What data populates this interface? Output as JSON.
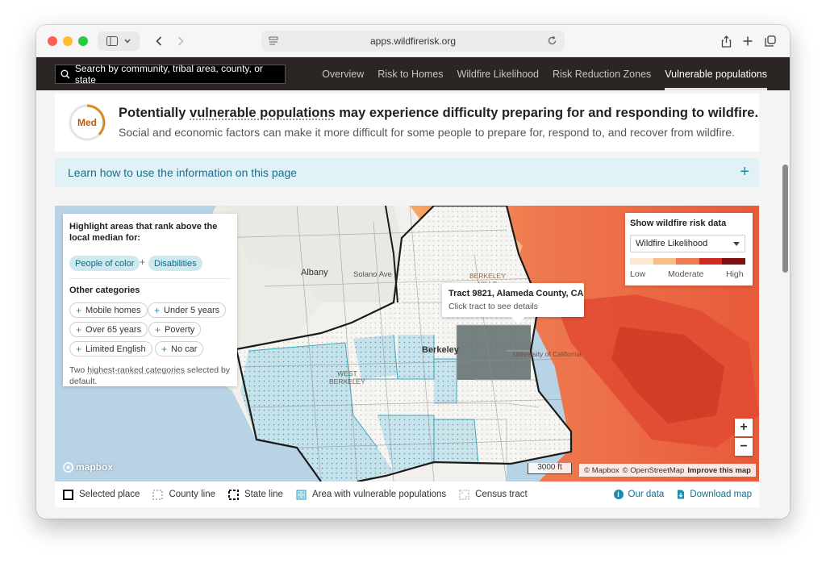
{
  "browser": {
    "url": "apps.wildfirerisk.org"
  },
  "nav": {
    "search_placeholder": "Search by community, tribal area, county, or state",
    "tabs": [
      "Overview",
      "Risk to Homes",
      "Wildfire Likelihood",
      "Risk Reduction Zones",
      "Vulnerable populations"
    ],
    "active_tab": "Vulnerable populations"
  },
  "banner": {
    "gauge_label": "Med",
    "title_pre": "Potentially ",
    "title_link": "vulnerable populations",
    "title_post": " may experience difficulty preparing for and responding to wildfire.",
    "subtitle": "Social and economic factors can make it more difficult for some people to prepare for, respond to, and recover from wildfire."
  },
  "learn": {
    "label": "Learn how to use the information on this page",
    "plus": "+"
  },
  "map": {
    "panel": {
      "heading": "Highlight areas that rank above the local median for:",
      "selected": [
        "People of color",
        "Disabilities"
      ],
      "joiner": "+",
      "other_heading": "Other categories",
      "other": [
        "Mobile homes",
        "Under 5 years",
        "Over 65 years",
        "Poverty",
        "Limited English",
        "No car"
      ],
      "note_pre": "Two ",
      "note_link": "highest-ranked categories",
      "note_post": " selected by default."
    },
    "tooltip": {
      "title": "Tract 9821, Alameda County, CA",
      "subtitle": "Click tract to see details"
    },
    "risk": {
      "title": "Show wildfire risk data",
      "selected": "Wildfire Likelihood",
      "low": "Low",
      "moderate": "Moderate",
      "high": "High",
      "colors": [
        "#fde9cf",
        "#f9bd8a",
        "#ef7a4f",
        "#cf2a20",
        "#7e1010"
      ]
    },
    "labels": {
      "albany": "Albany",
      "solano": "Solano Ave",
      "berkeley": "Berkeley",
      "west_berkeley": "WEST\nBERKELEY",
      "berkeley_hills": "BERKELEY\nHILLS",
      "uc": "University of California"
    },
    "zoom_in": "+",
    "zoom_out": "−",
    "mapbox": "mapbox",
    "scale": "3000 ft",
    "attribution": [
      "© Mapbox",
      "© OpenStreetMap",
      "Improve this map"
    ]
  },
  "legend": {
    "items": [
      "Selected place",
      "County line",
      "State line",
      "Area with vulnerable populations",
      "Census tract"
    ],
    "our_data": "Our data",
    "download": "Download map"
  },
  "colors": {
    "accent": "#1a8fb0",
    "nav_bg": "#2b2524",
    "gauge": "#d98a1f"
  }
}
